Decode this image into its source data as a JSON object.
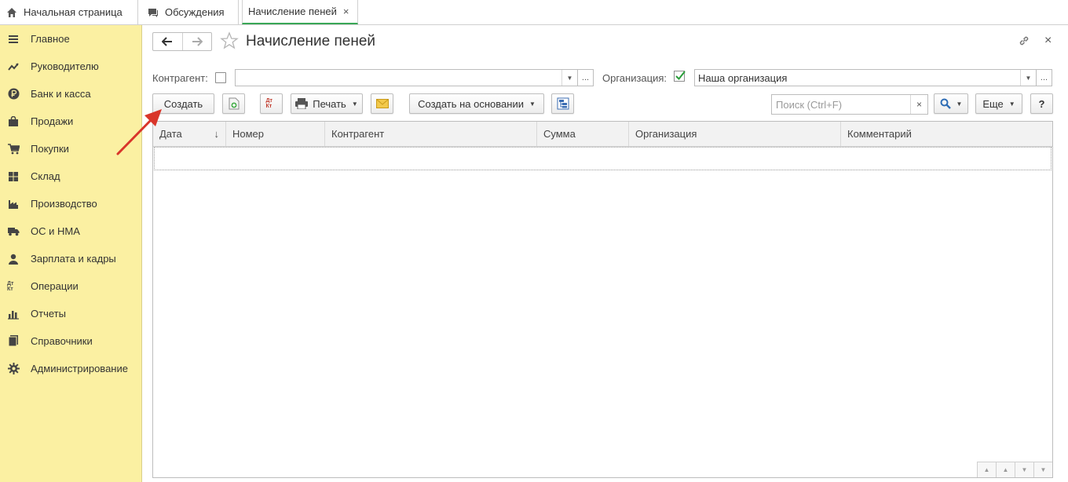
{
  "tabs": [
    {
      "label": "Начальная страница",
      "icon": "home-icon"
    },
    {
      "label": "Обсуждения",
      "icon": "chat-icon"
    },
    {
      "label": "Начисление пеней",
      "close": "×"
    }
  ],
  "sidebar": {
    "items": [
      {
        "label": "Главное",
        "icon": "menu-icon"
      },
      {
        "label": "Руководителю",
        "icon": "trend-icon"
      },
      {
        "label": "Банк и касса",
        "icon": "ruble-icon"
      },
      {
        "label": "Продажи",
        "icon": "bag-icon"
      },
      {
        "label": "Покупки",
        "icon": "cart-icon"
      },
      {
        "label": "Склад",
        "icon": "warehouse-icon"
      },
      {
        "label": "Производство",
        "icon": "factory-icon"
      },
      {
        "label": "ОС и НМА",
        "icon": "truck-icon"
      },
      {
        "label": "Зарплата и кадры",
        "icon": "person-icon"
      },
      {
        "label": "Операции",
        "icon": "dt-kt-icon",
        "icon_text": "Дт Кт"
      },
      {
        "label": "Отчеты",
        "icon": "bar-chart-icon"
      },
      {
        "label": "Справочники",
        "icon": "books-icon"
      },
      {
        "label": "Администрирование",
        "icon": "gear-icon"
      }
    ]
  },
  "header": {
    "title": "Начисление пеней",
    "close": "×"
  },
  "filters": {
    "counterparty_label": "Контрагент:",
    "counterparty_value": "",
    "organization_label": "Организация:",
    "organization_value": "Наша организация",
    "ellipsis": "..."
  },
  "toolbar": {
    "create_label": "Создать",
    "dtkt_text": "Дт Кт",
    "print_label": "Печать",
    "create_based_label": "Создать на основании",
    "search_placeholder": "Поиск (Ctrl+F)",
    "search_clear": "×",
    "more_label": "Еще",
    "help_label": "?"
  },
  "table": {
    "columns": [
      "Дата",
      "Номер",
      "Контрагент",
      "Сумма",
      "Организация",
      "Комментарий"
    ],
    "sort_indicator": "↓",
    "rows": []
  },
  "colors": {
    "sidebar_bg": "#fbf0a2",
    "active_tab_underline": "#3aa757",
    "annotation_arrow": "#d9352a"
  }
}
